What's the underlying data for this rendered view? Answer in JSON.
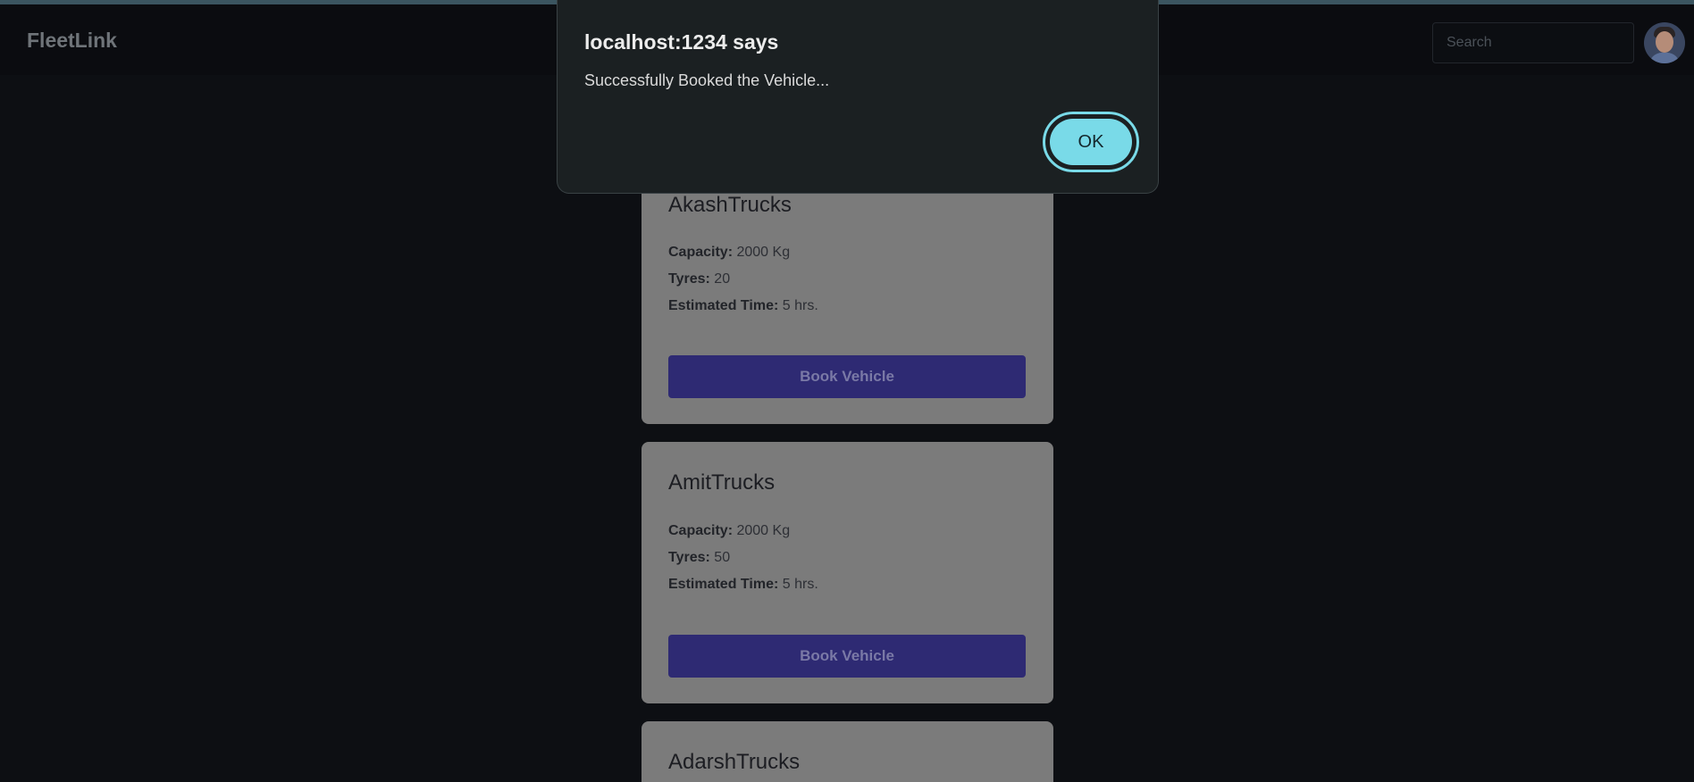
{
  "navbar": {
    "brand": "FleetLink",
    "search_placeholder": "Search",
    "avatar_icon": "user-avatar-icon"
  },
  "vehicles": [
    {
      "name": "AkashTrucks",
      "capacity_label": "Capacity:",
      "capacity_value": "2000 Kg",
      "tyres_label": "Tyres:",
      "tyres_value": "20",
      "time_label": "Estimated Time:",
      "time_value": "5 hrs.",
      "button_label": "Book Vehicle"
    },
    {
      "name": "AmitTrucks",
      "capacity_label": "Capacity:",
      "capacity_value": "2000 Kg",
      "tyres_label": "Tyres:",
      "tyres_value": "50",
      "time_label": "Estimated Time:",
      "time_value": "5 hrs.",
      "button_label": "Book Vehicle"
    },
    {
      "name": "AdarshTrucks"
    }
  ],
  "alert": {
    "title": "localhost:1234 says",
    "message": "Successfully Booked the Vehicle...",
    "ok_label": "OK"
  },
  "colors": {
    "page_bg": "#0d0f13",
    "card_bg": "#7b7b7b",
    "book_button": "#2e2a73",
    "dialog_bg": "#1b2022",
    "ok_button": "#79dae8"
  }
}
